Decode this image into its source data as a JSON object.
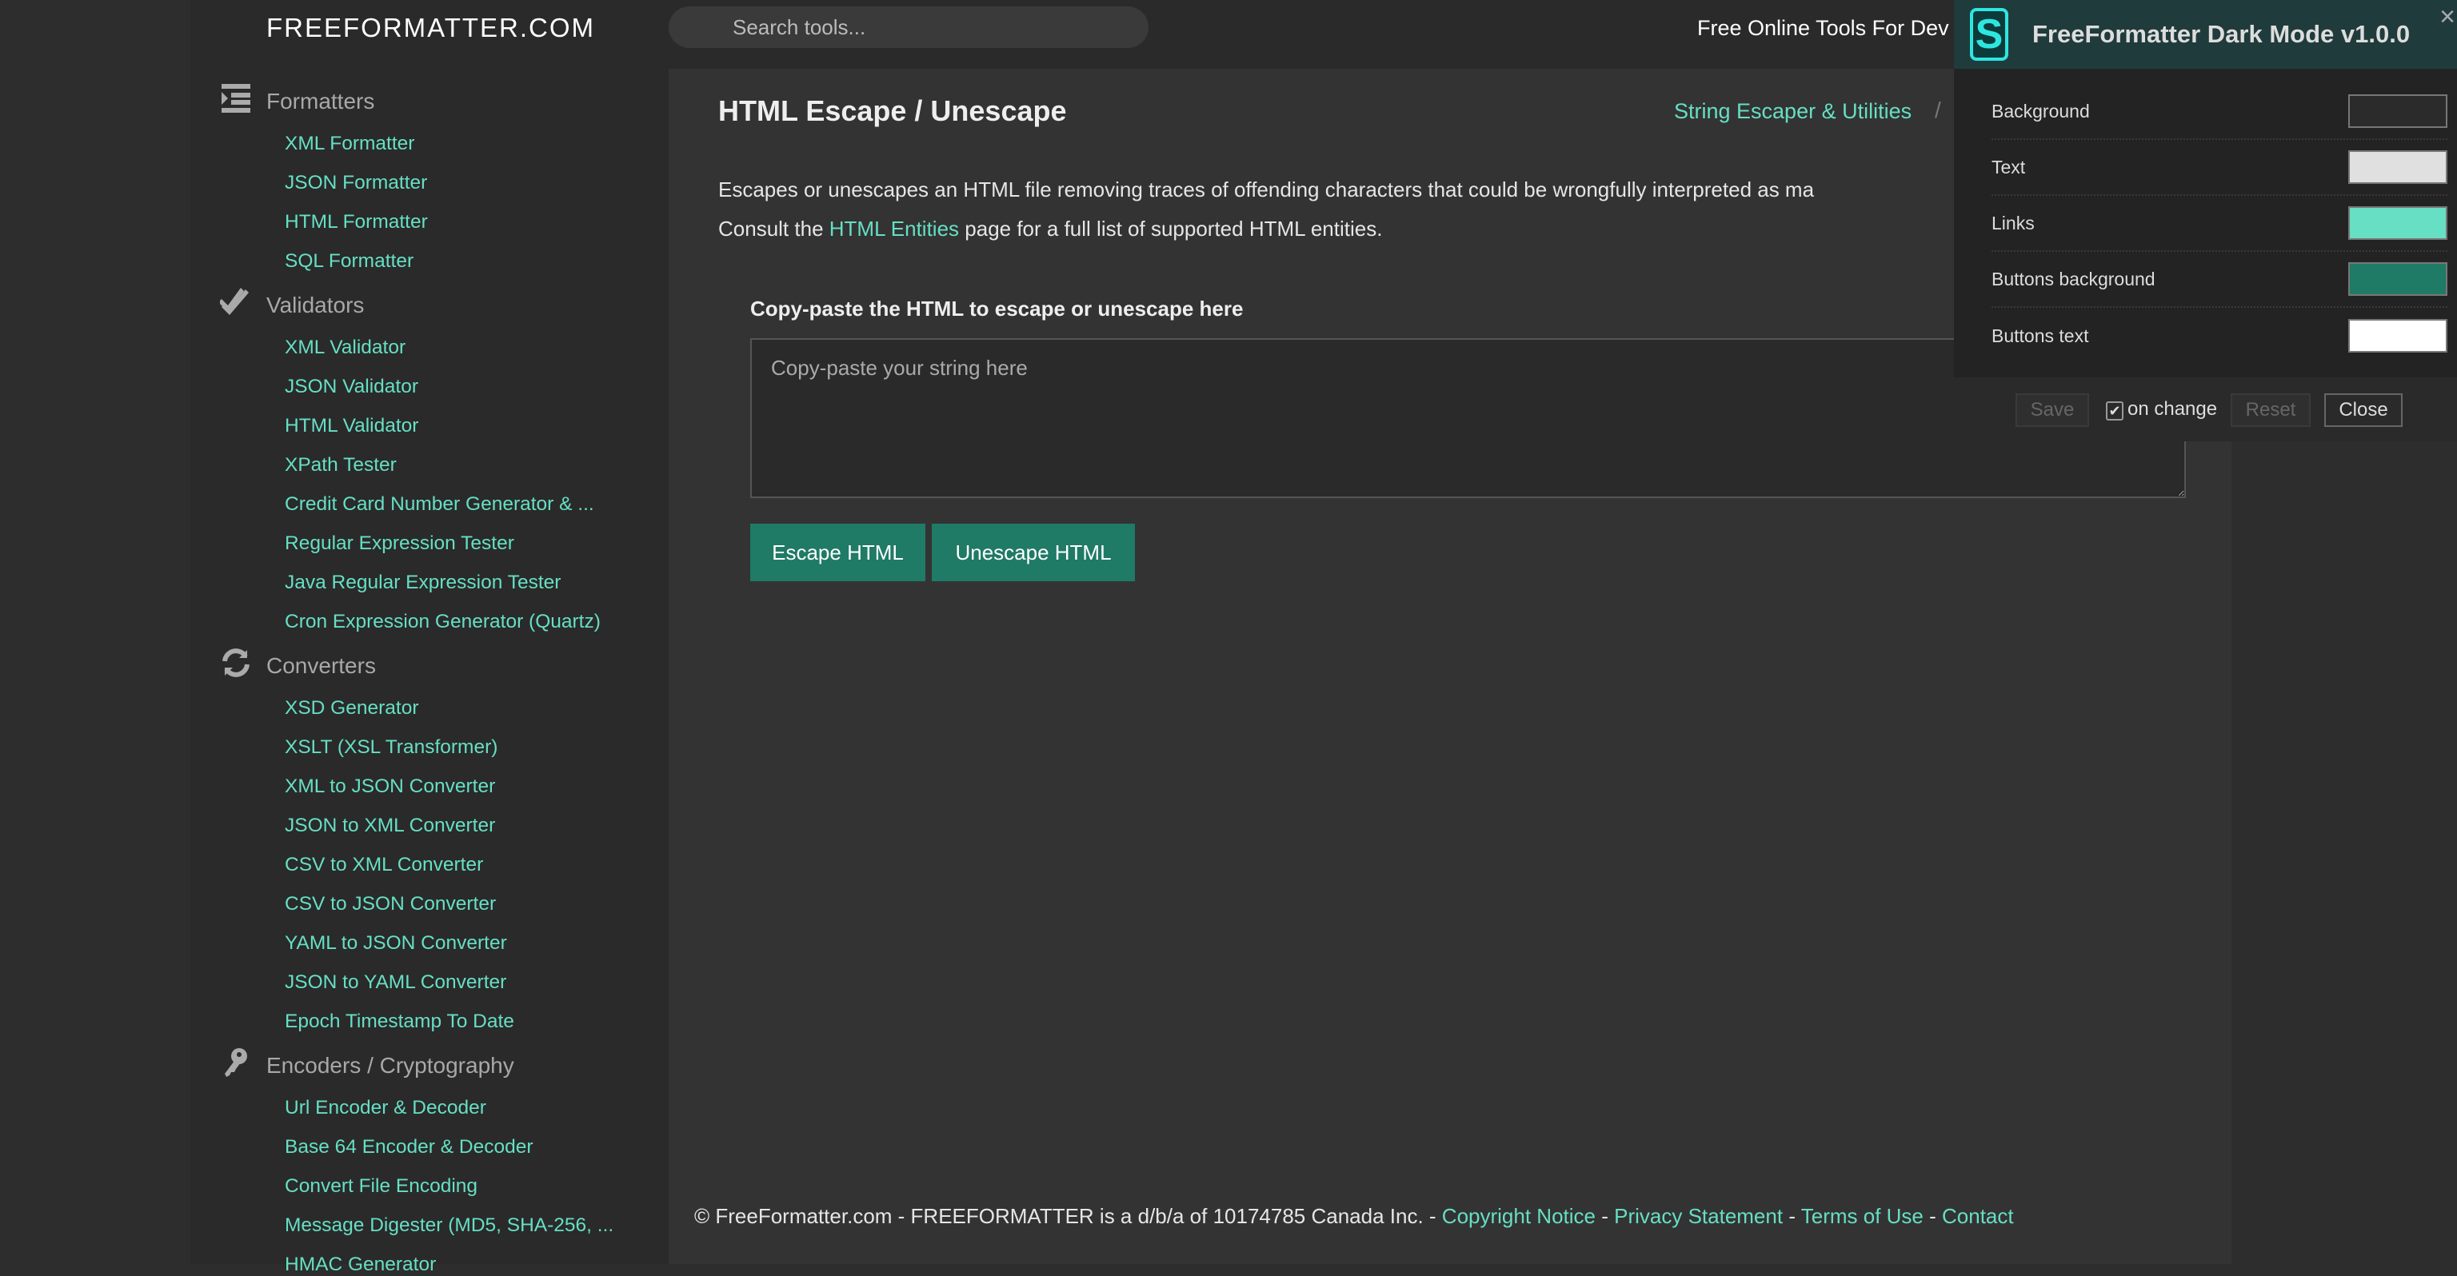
{
  "header": {
    "logo": "FREEFORMATTER.COM",
    "search_placeholder": "Search tools...",
    "tagline": "Free Online Tools For Dev"
  },
  "sidebar": {
    "sections": [
      {
        "title": "Formatters",
        "icon": "indent-icon",
        "items": [
          "XML Formatter",
          "JSON Formatter",
          "HTML Formatter",
          "SQL Formatter"
        ]
      },
      {
        "title": "Validators",
        "icon": "double-check-icon",
        "items": [
          "XML Validator",
          "JSON Validator",
          "HTML Validator",
          "XPath Tester",
          "Credit Card Number Generator & ...",
          "Regular Expression Tester",
          "Java Regular Expression Tester",
          "Cron Expression Generator (Quartz)"
        ]
      },
      {
        "title": "Converters",
        "icon": "refresh-icon",
        "items": [
          "XSD Generator",
          "XSLT (XSL Transformer)",
          "XML to JSON Converter",
          "JSON to XML Converter",
          "CSV to XML Converter",
          "CSV to JSON Converter",
          "YAML to JSON Converter",
          "JSON to YAML Converter",
          "Epoch Timestamp To Date"
        ]
      },
      {
        "title": "Encoders / Cryptography",
        "icon": "key-icon",
        "items": [
          "Url Encoder & Decoder",
          "Base 64 Encoder & Decoder",
          "Convert File Encoding",
          "Message Digester (MD5, SHA-256, ...",
          "HMAC Generator"
        ]
      }
    ]
  },
  "main": {
    "title": "HTML Escape / Unescape",
    "breadcrumb": "String Escaper & Utilities",
    "breadcrumb_sep": "/",
    "description": "Escapes or unescapes an HTML file removing traces of offending characters that could be wrongfully interpreted as ma",
    "consult_prefix": "Consult the ",
    "consult_link": "HTML Entities",
    "consult_suffix": " page for a full list of supported HTML entities.",
    "input_label": "Copy-paste the HTML to escape or unescape here",
    "input_placeholder": "Copy-paste your string here",
    "escape_button": "Escape HTML",
    "unescape_button": "Unescape HTML"
  },
  "footer": {
    "text": "© FreeFormatter.com - FREEFORMATTER is a d/b/a of 10174785 Canada Inc. - ",
    "links": [
      "Copyright Notice",
      "Privacy Statement",
      "Terms of Use",
      "Contact"
    ],
    "sep": " - "
  },
  "panel": {
    "title": "FreeFormatter Dark Mode v1.0.0",
    "logo_letter": "S",
    "close_glyph": "×",
    "settings": [
      {
        "label": "Background",
        "color": "#2b2b2b"
      },
      {
        "label": "Text",
        "color": "#e0e0e0"
      },
      {
        "label": "Links",
        "color": "#66dfc4"
      },
      {
        "label": "Buttons background",
        "color": "#1f7a66"
      },
      {
        "label": "Buttons text",
        "color": "#ffffff"
      }
    ],
    "save": "Save",
    "on_change": "on change",
    "on_change_checked": true,
    "reset": "Reset",
    "close": "Close"
  },
  "colors": {
    "accent": "#66dfc4",
    "button": "#1f7a66",
    "background": "#333333"
  }
}
